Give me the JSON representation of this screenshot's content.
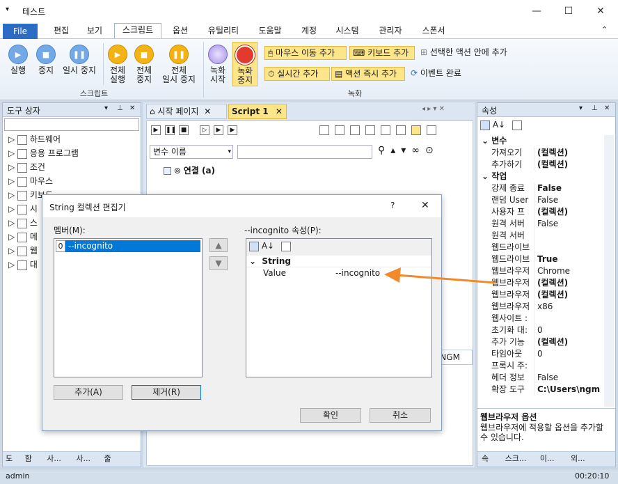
{
  "window": {
    "title": "테스트",
    "minimize": "—",
    "maximize": "☐",
    "close": "✕"
  },
  "menu": [
    "File",
    "편집",
    "보기",
    "스크립트",
    "옵션",
    "유틸리티",
    "도움말",
    "계정",
    "시스템",
    "관리자",
    "스폰서"
  ],
  "ribbon": {
    "script_group": "스크립트",
    "record_group": "녹화",
    "run": "실행",
    "stop": "중지",
    "pause": "일시 중지",
    "run_all": [
      "전체",
      "실행"
    ],
    "stop_all": [
      "전체",
      "중지"
    ],
    "pause_all": [
      "전체",
      "일시 중지"
    ],
    "rec_start": [
      "녹화",
      "시작"
    ],
    "rec_stop": [
      "녹화",
      "중지"
    ],
    "add_mouse": "마우스 이동 추가",
    "add_keyboard": "키보드 추가",
    "add_in_action": "선택한 액션 안에 추가",
    "add_realtime": "실시간 추가",
    "add_action_now": "액션 즉시 추가",
    "event_done": "이벤트 완료"
  },
  "toolbox": {
    "title": "도구 상자",
    "items": [
      "하드웨어",
      "응용 프로그램",
      "조건",
      "마우스",
      "키보드",
      "시",
      "스",
      "메",
      "웹",
      "대"
    ],
    "tabs": [
      "도",
      "함",
      "사...",
      "사...",
      "줄"
    ]
  },
  "editor": {
    "tabs": [
      "시작 페이지",
      "Script 1"
    ],
    "var_dropdown": "변수 이름",
    "node": "연결 (a)",
    "path_frag": "s\\NGM"
  },
  "props": {
    "title": "속성",
    "sections": [
      {
        "name": "변수",
        "rows": [
          [
            "가져오기",
            "(컬렉션)",
            true
          ],
          [
            "추가하기",
            "(컬렉션)",
            true
          ]
        ]
      },
      {
        "name": "작업",
        "rows": [
          [
            "강제 종료",
            "False",
            true
          ],
          [
            "랜덤 User",
            "False",
            false
          ],
          [
            "사용자 프",
            "(컬렉션)",
            true
          ],
          [
            "원격 서버",
            "False",
            false
          ],
          [
            "원격 서버",
            "",
            false
          ],
          [
            "웹드라이브",
            "",
            false
          ],
          [
            "웹드라이브",
            "True",
            true
          ],
          [
            "웹브라우저",
            "Chrome",
            false
          ],
          [
            "웹브라우저",
            "(컬렉션)",
            true
          ],
          [
            "웹브라우저",
            "(컬렉션)",
            true
          ],
          [
            "웹브라우저",
            "x86",
            false
          ],
          [
            "웹사이트 :",
            "",
            false
          ],
          [
            "초기화 대:",
            "0",
            false
          ],
          [
            "추가 기능",
            "(컬렉션)",
            true
          ],
          [
            "타임아웃",
            "0",
            false
          ],
          [
            "프록시 주:",
            "",
            false
          ],
          [
            "헤더 정보",
            "False",
            false
          ],
          [
            "확장 도구",
            "C:\\Users\\ngm",
            true
          ]
        ]
      }
    ],
    "desc_title": "웹브라우저 옵션",
    "desc_text": "웹브라우저에 적용할 옵션을 추가할 수 있습니다.",
    "tabs": [
      "속",
      "스크...",
      "이...",
      "외..."
    ]
  },
  "dialog": {
    "title": "String 컬렉션 편집기",
    "help": "?",
    "close": "✕",
    "members_label": "멤버(M):",
    "member_index": "0",
    "member_value": "--incognito",
    "props_label": "--incognito 속성(P):",
    "category": "String",
    "prop_name": "Value",
    "prop_value": "--incognito",
    "add": "추가(A)",
    "remove": "제거(R)",
    "ok": "확인",
    "cancel": "취소"
  },
  "status": {
    "user": "admin",
    "time": "00:20:10"
  }
}
